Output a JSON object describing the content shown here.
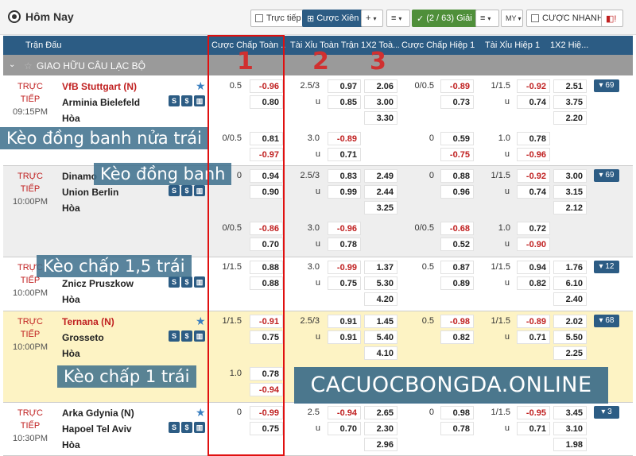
{
  "topbar": {
    "title": "Hôm Nay",
    "live_label": "Trực tiếp",
    "parlay_label": "Cược Xiên",
    "plus_label": "+",
    "sort_label": "≡",
    "leagues_label": "(2 / 63) Giải",
    "menu_label": "≡",
    "odds_type_label": "MY",
    "quick_bet_label": "CƯỢC NHANH"
  },
  "header": {
    "match": "Trận Đấu",
    "ah_full": "Cược Chấp Toàn ...",
    "ou_full": "Tài Xỉu Toàn Trận",
    "x12_full": "1X2 Toà...",
    "ah_half": "Cược Chấp Hiệp 1",
    "ou_half": "Tài Xỉu Hiệp 1",
    "x12_half": "1X2 Hiệ..."
  },
  "league": {
    "name": "GIAO HỮU CÂU LẠC BỘ"
  },
  "overlays": {
    "o1": "Kèo đồng banh nửa trái",
    "o2": "Kèo đồng banh",
    "o3": "Kèo chấp 1,5 trái",
    "o4": "Kèo chấp 1 trái",
    "n1": "1",
    "n2": "2",
    "n3": "3",
    "watermark": "CACUOCBONGDA.ONLINE"
  },
  "matches": [
    {
      "status": "TRỰC",
      "status2": "TIẾP",
      "time": "09:15PM",
      "home": "VfB Stuttgart (N)",
      "away": "Arminia Bielefeld",
      "draw": "Hòa",
      "more": "▾ 69",
      "r1": {
        "ah": "0.5",
        "ah_h": "-0.96",
        "ou": "2.5/3",
        "ou_o": "0.97",
        "x1": "2.06",
        "hah": "0/0.5",
        "hah_h": "-0.89",
        "hou": "1/1.5",
        "hou_o": "-0.92",
        "hx1": "2.51"
      },
      "r2": {
        "ah_a": "0.80",
        "u": "u",
        "ou_u": "0.85",
        "x2": "3.00",
        "hah_a": "0.73",
        "hu": "u",
        "hou_u": "0.74",
        "hx2": "3.75"
      },
      "r3": {
        "xd": "3.30",
        "hxd": "2.20"
      },
      "r4": {
        "ah": "0/0.5",
        "ah_h": "0.81",
        "ou": "3.0",
        "ou_o": "-0.89",
        "hah": "0",
        "hah_h": "0.59",
        "hou": "1.0",
        "hou_o": "0.78"
      },
      "r5": {
        "ah_a": "-0.97",
        "u": "u",
        "ou_u": "0.71",
        "hah_a": "-0.75",
        "hu": "u",
        "hou_u": "-0.96"
      }
    },
    {
      "status": "TRỰC",
      "status2": "TIẾP",
      "time": "10:00PM",
      "home": "Dinamo",
      "away": "Union Berlin",
      "draw": "Hòa",
      "more": "▾ 69",
      "r1": {
        "ah": "0",
        "ah_h": "0.94",
        "ou": "2.5/3",
        "ou_o": "0.83",
        "x1": "2.49",
        "hah": "0",
        "hah_h": "0.88",
        "hou": "1/1.5",
        "hou_o": "-0.92",
        "hx1": "3.00"
      },
      "r2": {
        "ah_a": "0.90",
        "u": "u",
        "ou_u": "0.99",
        "x2": "2.44",
        "hah_a": "0.96",
        "hu": "u",
        "hou_u": "0.74",
        "hx2": "3.15"
      },
      "r3": {
        "xd": "3.25",
        "hxd": "2.12"
      },
      "r4": {
        "ah": "0/0.5",
        "ah_h": "-0.86",
        "ou": "3.0",
        "ou_o": "-0.96",
        "hah": "0/0.5",
        "hah_h": "-0.68",
        "hou": "1.0",
        "hou_o": "0.72"
      },
      "r5": {
        "ah_a": "0.70",
        "u": "u",
        "ou_u": "0.78",
        "hah_a": "0.52",
        "hu": "u",
        "hou_u": "-0.90"
      }
    },
    {
      "status": "TRỰC",
      "status2": "TIẾP",
      "time": "10:00PM",
      "home": "",
      "away": "Znicz Pruszkow",
      "draw": "Hòa",
      "more": "▾ 12",
      "r1": {
        "ah": "1/1.5",
        "ah_h": "0.88",
        "ou": "3.0",
        "ou_o": "-0.99",
        "x1": "1.37",
        "hah": "0.5",
        "hah_h": "0.87",
        "hou": "1/1.5",
        "hou_o": "0.94",
        "hx1": "1.76"
      },
      "r2": {
        "ah_a": "0.88",
        "u": "u",
        "ou_u": "0.75",
        "x2": "5.30",
        "hah_a": "0.89",
        "hu": "u",
        "hou_u": "0.82",
        "hx2": "6.10"
      },
      "r3": {
        "xd": "4.20",
        "hxd": "2.40"
      }
    },
    {
      "status": "TRỰC",
      "status2": "TIẾP",
      "time": "10:00PM",
      "home": "Ternana (N)",
      "away": "Grosseto",
      "draw": "Hòa",
      "more": "▾ 68",
      "r1": {
        "ah": "1/1.5",
        "ah_h": "-0.91",
        "ou": "2.5/3",
        "ou_o": "0.91",
        "x1": "1.45",
        "hah": "0.5",
        "hah_h": "-0.98",
        "hou": "1/1.5",
        "hou_o": "-0.89",
        "hx1": "2.02"
      },
      "r2": {
        "ah_a": "0.75",
        "u": "u",
        "ou_u": "0.91",
        "x2": "5.40",
        "hah_a": "0.82",
        "hu": "u",
        "hou_u": "0.71",
        "hx2": "5.50"
      },
      "r3": {
        "xd": "4.10",
        "hxd": "2.25"
      },
      "r4": {
        "ah": "1.0",
        "ah_h": "0.78"
      },
      "r5": {
        "ah_a": "-0.94"
      }
    },
    {
      "status": "TRỰC",
      "status2": "TIẾP",
      "time": "10:30PM",
      "home": "Arka Gdynia (N)",
      "away": "Hapoel Tel Aviv",
      "draw": "Hòa",
      "more": "▾ 3",
      "r1": {
        "ah": "0",
        "ah_h": "-0.99",
        "ou": "2.5",
        "ou_o": "-0.94",
        "x1": "2.65",
        "hah": "0",
        "hah_h": "0.98",
        "hou": "1/1.5",
        "hou_o": "-0.95",
        "hx1": "3.45"
      },
      "r2": {
        "ah_a": "0.75",
        "u": "u",
        "ou_u": "0.70",
        "x2": "2.30",
        "hah_a": "0.78",
        "hu": "u",
        "hou_u": "0.71",
        "hx2": "3.10"
      },
      "r3": {
        "xd": "2.96",
        "hxd": "1.98"
      }
    }
  ]
}
